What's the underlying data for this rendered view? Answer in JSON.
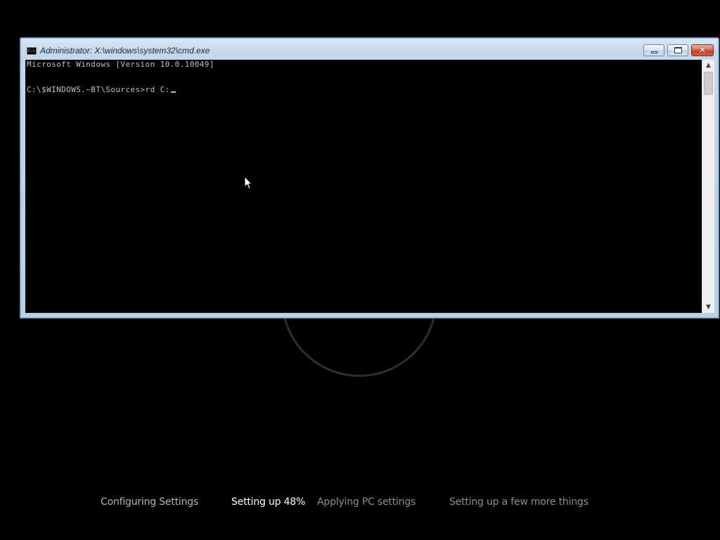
{
  "window": {
    "title": "Administrator: X:\\windows\\system32\\cmd.exe",
    "icon_name": "console-icon",
    "icon_glyph": "C:\\",
    "controls": {
      "minimize_icon": "minimize-icon",
      "maximize_icon": "maximize-icon",
      "close_icon": "close-icon",
      "close_glyph": "✕"
    }
  },
  "console": {
    "lines": [
      "Microsoft Windows [Version 10.0.10049]",
      "C:\\$WINDOWS.~BT\\Sources>rd C:"
    ],
    "text_color": "#c0c0c0",
    "background_color": "#000000"
  },
  "scrollbar": {
    "up_glyph": "▲",
    "down_glyph": "▼"
  },
  "setup": {
    "steps": [
      {
        "label": "Configuring Settings",
        "state": "done"
      },
      {
        "label": "Setting up 48%",
        "state": "active"
      },
      {
        "label": "Applying PC settings",
        "state": "pending"
      },
      {
        "label": "Setting up a few more things",
        "state": "pending"
      }
    ],
    "progress_percent": 48
  },
  "colors": {
    "screen_background": "#000000",
    "close_button": "#c4412a",
    "titlebar": "#c4d8ec"
  }
}
